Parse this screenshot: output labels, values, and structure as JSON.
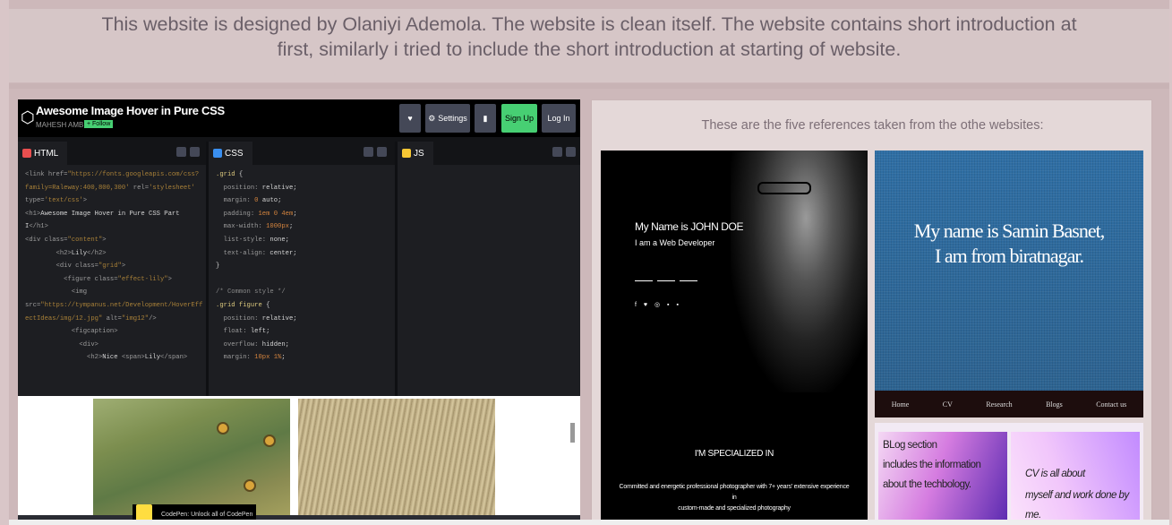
{
  "intro": {
    "line1": "This website is designed by Olaniyi Ademola. The website is clean itself. The website contains short introduction at",
    "line2": "first, similarly i tried to include the short introduction at starting of website."
  },
  "codepen": {
    "title": "Awesome Image Hover in Pure CSS",
    "author": "MAHESH AMBURE",
    "follow": "+ Follow",
    "settings": "Settings",
    "signup": "Sign Up",
    "login": "Log In",
    "tabs": {
      "html": "HTML",
      "css": "CSS",
      "js": "JS"
    },
    "toast": "CodePen: Unlock all of CodePen"
  },
  "references": {
    "heading": "These are the five references taken from the othe websites:",
    "jd_name": "My Name is JOHN DOE",
    "jd_role": "I am a Web Developer",
    "jd_specialized": "I'M SPECIALIZED IN",
    "jd_desc1": "Committed and energetic professional photographer with 7+ years' extensive experience in",
    "jd_desc2": "custom-made and specialized photography",
    "sb_line1": "My name is Samin Basnet,",
    "sb_line2": "I am from biratnagar.",
    "sb_nav": [
      "Home",
      "CV",
      "Research",
      "Blogs",
      "Contact us"
    ],
    "card1": [
      "BLog section",
      "includes the information",
      "about the techbology."
    ],
    "card2": [
      "CV is all about",
      "myself and work done by me."
    ]
  },
  "colors": {
    "background": "#d9c6c8",
    "codepen_green": "#47cf73",
    "html_badge": "#e94f4f",
    "css_badge": "#3a8ff0",
    "js_badge": "#f7c734"
  }
}
